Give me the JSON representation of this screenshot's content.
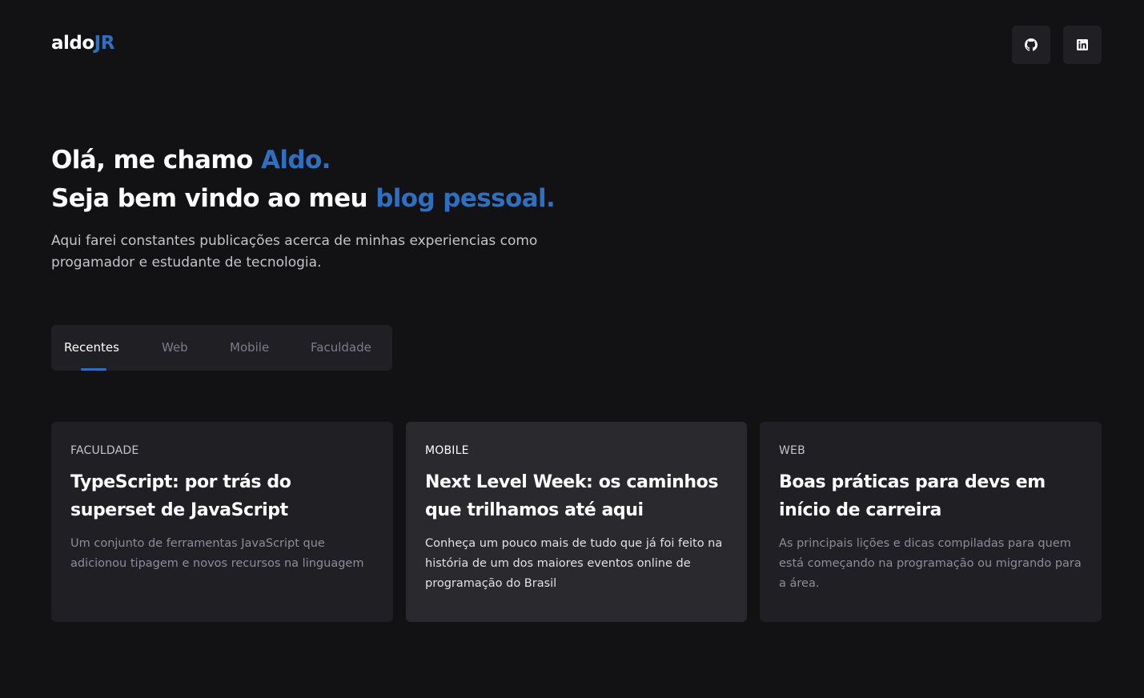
{
  "header": {
    "logo_main": "aldo",
    "logo_accent": "JR",
    "social": [
      {
        "icon": "github-icon",
        "label": "GitHub"
      },
      {
        "icon": "linkedin-icon",
        "label": "LinkedIn"
      }
    ]
  },
  "hero": {
    "line1_prefix": "Olá, me chamo ",
    "line1_accent": "Aldo.",
    "line2_prefix": "Seja bem vindo ao meu ",
    "line2_accent": "blog pessoal.",
    "description": "Aqui farei constantes publicações acerca de minhas experiencias como progamador e estudante de tecnologia."
  },
  "tabs": {
    "items": [
      "Recentes",
      "Web",
      "Mobile",
      "Faculdade"
    ],
    "active": "Recentes"
  },
  "posts": [
    {
      "tag": "FACULDADE",
      "title": "TypeScript: por trás do superset de JavaScript",
      "description": "Um conjunto de ferramentas JavaScript que adicionou tipagem e novos recursos na linguagem"
    },
    {
      "tag": "MOBILE",
      "title": "Next Level Week: os caminhos que trilhamos até aqui",
      "description": "Conheça um pouco mais de tudo que já foi feito na história de um dos maiores eventos online de programação do Brasil"
    },
    {
      "tag": "WEB",
      "title": "Boas práticas para devs em início de carreira",
      "description": "As principais lições e dicas compiladas para quem está começando na programação ou migrando para a área."
    }
  ],
  "colors": {
    "background": "#121214",
    "surface": "#202024",
    "surface_highlight": "#29292e",
    "accent": "#2f6fc2",
    "text": "#ffffff",
    "muted": "#8d8d99"
  }
}
